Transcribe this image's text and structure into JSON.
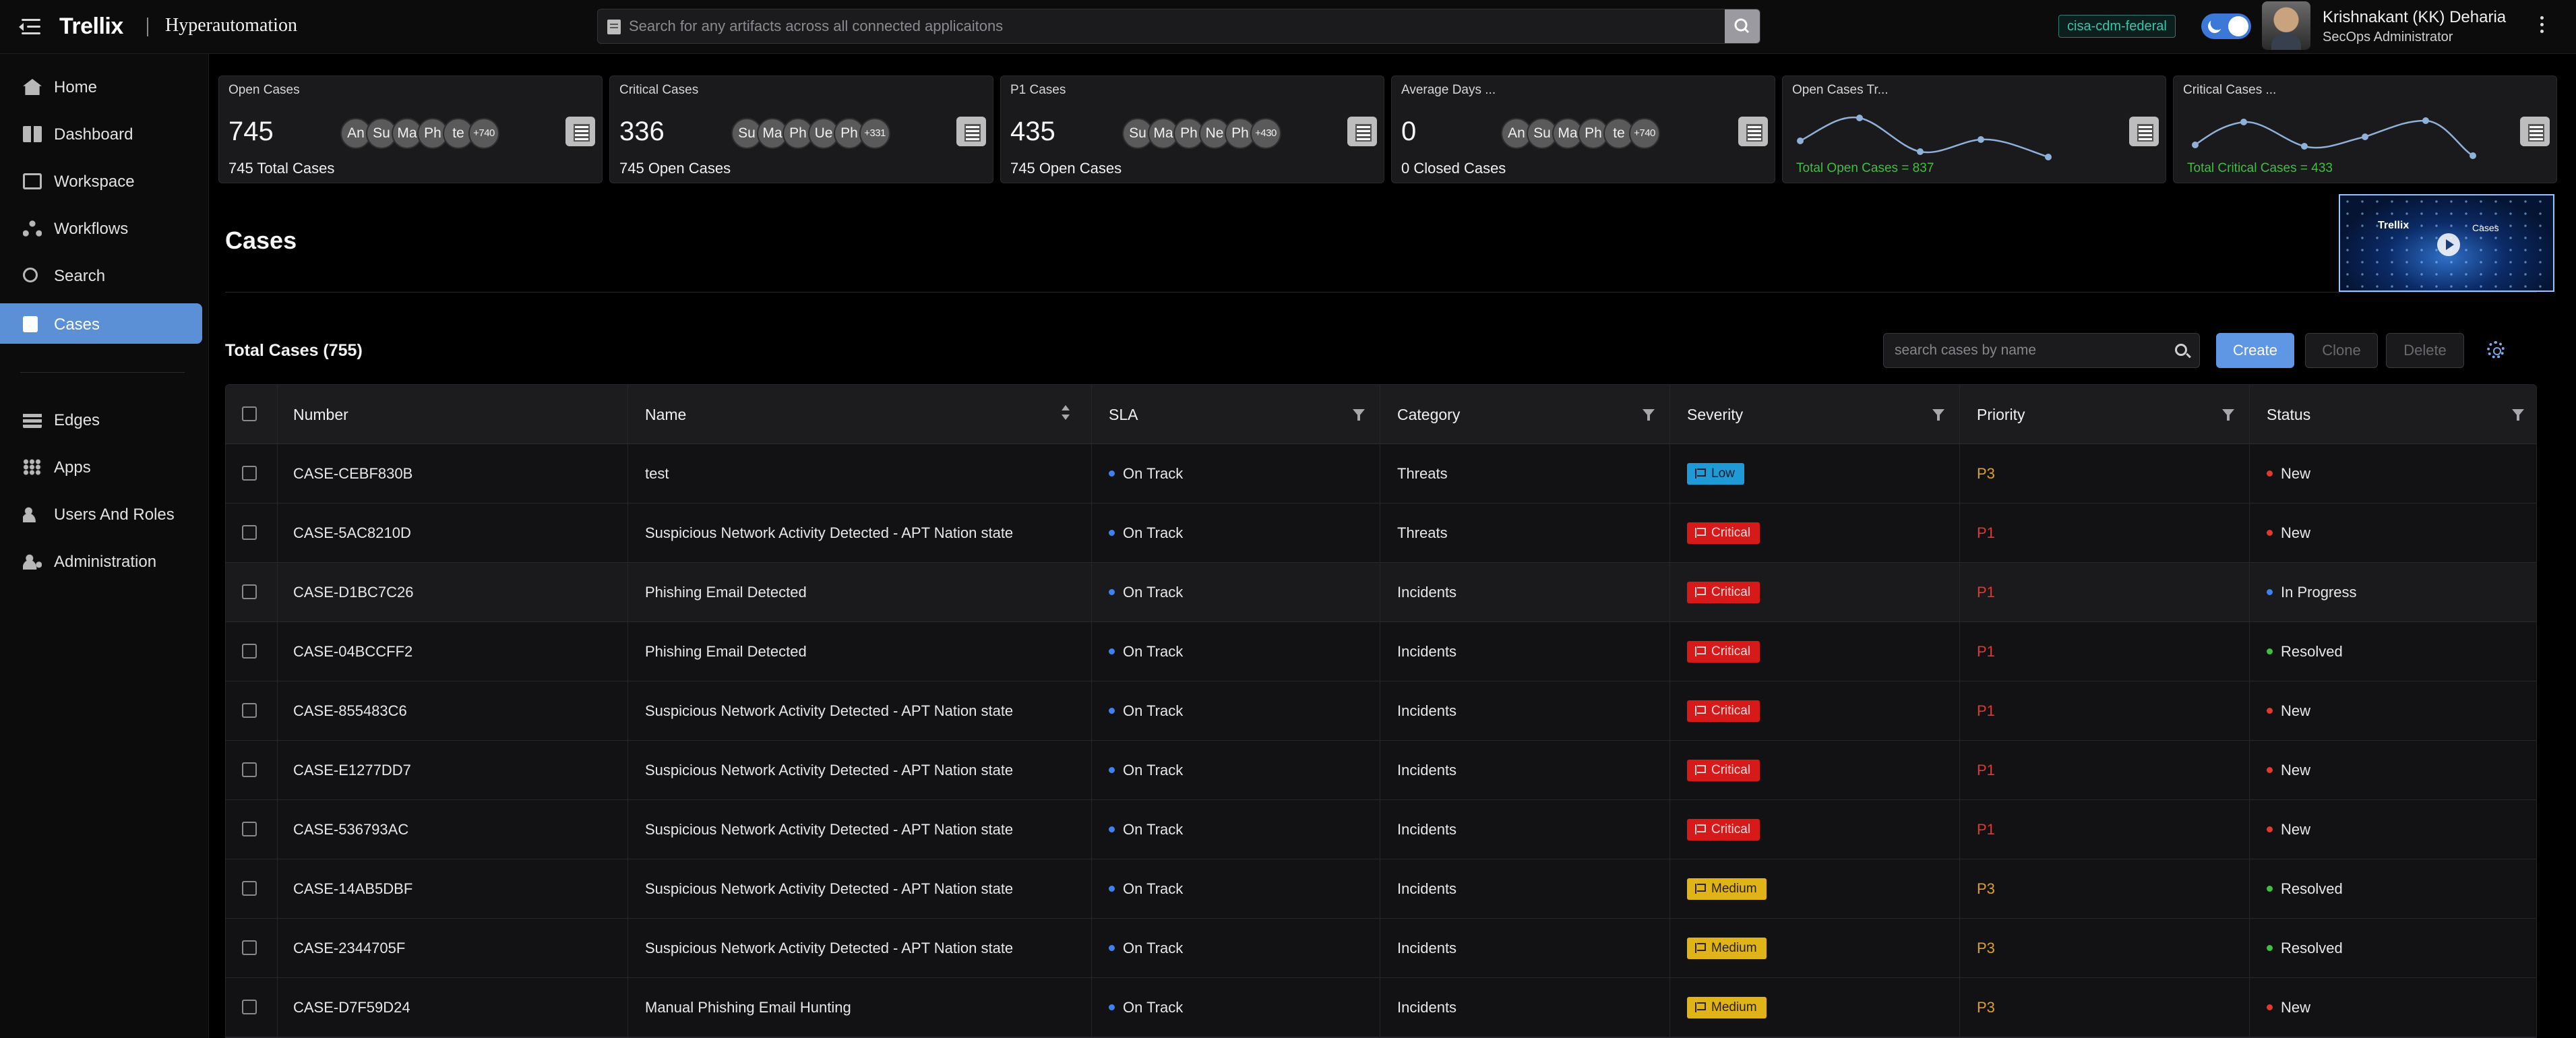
{
  "header": {
    "logo": "Trellix",
    "product": "Hyperautomation",
    "search_placeholder": "Search for any artifacts across all connected applicaitons",
    "env_chip": "cisa-cdm-federal",
    "user_name": "Krishnakant (KK) Deharia",
    "user_role": "SecOps Administrator"
  },
  "sidebar": {
    "items": [
      {
        "label": "Home",
        "icon": "home-icon"
      },
      {
        "label": "Dashboard",
        "icon": "dashboard-icon"
      },
      {
        "label": "Workspace",
        "icon": "workspace-icon"
      },
      {
        "label": "Workflows",
        "icon": "workflows-icon"
      },
      {
        "label": "Search",
        "icon": "search-icon"
      },
      {
        "label": "Cases",
        "icon": "cases-icon",
        "active": true
      },
      {
        "label": "Edges",
        "icon": "edges-icon"
      },
      {
        "label": "Apps",
        "icon": "apps-icon"
      },
      {
        "label": "Users And Roles",
        "icon": "users-icon"
      },
      {
        "label": "Administration",
        "icon": "administration-icon"
      }
    ]
  },
  "cards": [
    {
      "title": "Open Cases",
      "value": "745",
      "sub": "745 Total Cases",
      "avatars": [
        "An",
        "Su",
        "Ma",
        "Ph",
        "te"
      ],
      "more": "+740"
    },
    {
      "title": "Critical Cases",
      "value": "336",
      "sub": "745 Open Cases",
      "avatars": [
        "Su",
        "Ma",
        "Ph",
        "Ue",
        "Ph"
      ],
      "more": "+331"
    },
    {
      "title": "P1 Cases",
      "value": "435",
      "sub": "745 Open Cases",
      "avatars": [
        "Su",
        "Ma",
        "Ph",
        "Ne",
        "Ph"
      ],
      "more": "+430"
    },
    {
      "title": "Average Days ...",
      "value": "0",
      "sub": "0 Closed Cases",
      "avatars": [
        "An",
        "Su",
        "Ma",
        "Ph",
        "te"
      ],
      "more": "+740"
    },
    {
      "title": "Open Cases Tr...",
      "trend_label": "Total Open Cases = 837"
    },
    {
      "title": "Critical Cases ...",
      "trend_label": "Total Critical Cases = 433"
    }
  ],
  "page": {
    "title": "Cases",
    "video": {
      "logo": "Trellix",
      "caption": "Cases"
    },
    "total_title": "Total Cases (755)",
    "search_placeholder": "search cases by name",
    "create_label": "Create",
    "clone_label": "Clone",
    "delete_label": "Delete"
  },
  "table": {
    "columns": [
      "Number",
      "Name",
      "SLA",
      "Category",
      "Severity",
      "Priority",
      "Status"
    ],
    "rows": [
      {
        "number": "CASE-CEBF830B",
        "name": "test",
        "sla": "On Track",
        "category": "Threats",
        "severity": "Low",
        "priority": "P3",
        "status": "New"
      },
      {
        "number": "CASE-5AC8210D",
        "name": "Suspicious Network Activity Detected - APT Nation state",
        "sla": "On Track",
        "category": "Threats",
        "severity": "Critical",
        "priority": "P1",
        "status": "New"
      },
      {
        "number": "CASE-D1BC7C26",
        "name": "Phishing Email Detected",
        "sla": "On Track",
        "category": "Incidents",
        "severity": "Critical",
        "priority": "P1",
        "status": "In Progress"
      },
      {
        "number": "CASE-04BCCFF2",
        "name": "Phishing Email Detected",
        "sla": "On Track",
        "category": "Incidents",
        "severity": "Critical",
        "priority": "P1",
        "status": "Resolved"
      },
      {
        "number": "CASE-855483C6",
        "name": "Suspicious Network Activity Detected - APT Nation state",
        "sla": "On Track",
        "category": "Incidents",
        "severity": "Critical",
        "priority": "P1",
        "status": "New"
      },
      {
        "number": "CASE-E1277DD7",
        "name": "Suspicious Network Activity Detected - APT Nation state",
        "sla": "On Track",
        "category": "Incidents",
        "severity": "Critical",
        "priority": "P1",
        "status": "New"
      },
      {
        "number": "CASE-536793AC",
        "name": "Suspicious Network Activity Detected - APT Nation state",
        "sla": "On Track",
        "category": "Incidents",
        "severity": "Critical",
        "priority": "P1",
        "status": "New"
      },
      {
        "number": "CASE-14AB5DBF",
        "name": "Suspicious Network Activity Detected - APT Nation state",
        "sla": "On Track",
        "category": "Incidents",
        "severity": "Medium",
        "priority": "P3",
        "status": "Resolved"
      },
      {
        "number": "CASE-2344705F",
        "name": "Suspicious Network Activity Detected - APT Nation state",
        "sla": "On Track",
        "category": "Incidents",
        "severity": "Medium",
        "priority": "P3",
        "status": "Resolved"
      },
      {
        "number": "CASE-D7F59D24",
        "name": "Manual Phishing Email Hunting",
        "sla": "On Track",
        "category": "Incidents",
        "severity": "Medium",
        "priority": "P3",
        "status": "New"
      }
    ]
  },
  "colors": {
    "accent": "#5f97e4",
    "sla_dot": "#3c82f0",
    "severity": {
      "Low": "#1e9ad6",
      "Critical": "#d61a1a",
      "Medium": "#e0b416"
    },
    "priority": {
      "P1": "#e0392e",
      "P3": "#e0a026"
    },
    "status": {
      "New": "#e0392e",
      "In Progress": "#3c82f0",
      "Resolved": "#3fbf3f"
    },
    "trend_green": "#3fbf3f"
  }
}
